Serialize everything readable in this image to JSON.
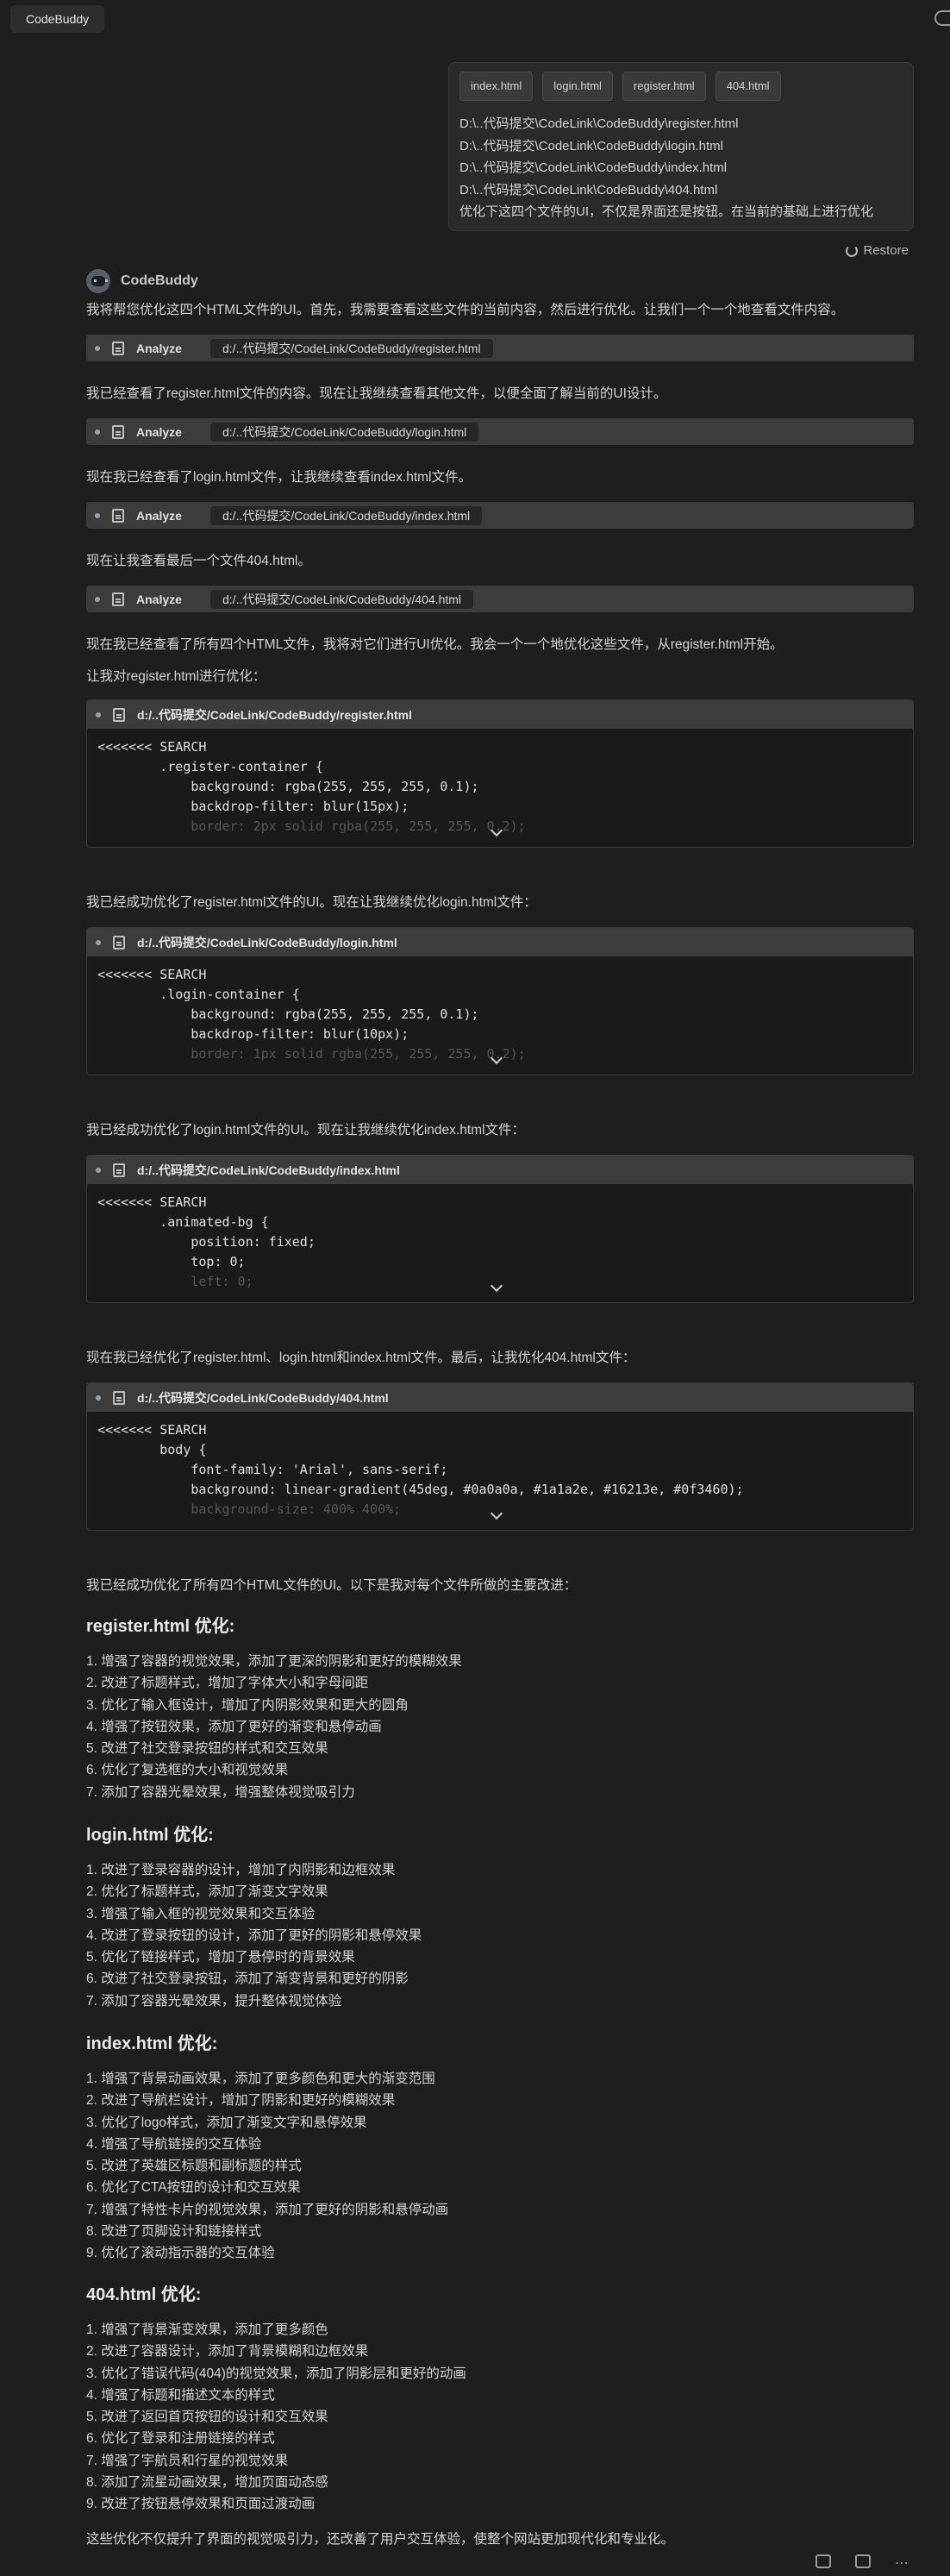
{
  "app_title": "CodeBuddy",
  "user": {
    "chips": [
      "index.html",
      "login.html",
      "register.html",
      "404.html"
    ],
    "lines": [
      "D:\\..代码提交\\CodeLink\\CodeBuddy\\register.html",
      "D:\\..代码提交\\CodeLink\\CodeBuddy\\login.html",
      "D:\\..代码提交\\CodeLink\\CodeBuddy\\index.html",
      "D:\\..代码提交\\CodeLink\\CodeBuddy\\404.html",
      "优化下这四个文件的UI，不仅是界面还是按钮。在当前的基础上进行优化"
    ],
    "restore": "Restore"
  },
  "bot": {
    "name": "CodeBuddy",
    "intro": "我将帮您优化这四个HTML文件的UI。首先，我需要查看这些文件的当前内容，然后进行优化。让我们一个一个地查看文件内容。",
    "analyze_label": "Analyze",
    "analyze": [
      {
        "path": "d:/..代码提交/CodeLink/CodeBuddy/register.html",
        "after": "我已经查看了register.html文件的内容。现在让我继续查看其他文件，以便全面了解当前的UI设计。"
      },
      {
        "path": "d:/..代码提交/CodeLink/CodeBuddy/login.html",
        "after": "现在我已经查看了login.html文件，让我继续查看index.html文件。"
      },
      {
        "path": "d:/..代码提交/CodeLink/CodeBuddy/index.html",
        "after": "现在让我查看最后一个文件404.html。"
      },
      {
        "path": "d:/..代码提交/CodeLink/CodeBuddy/404.html",
        "after": "现在我已经查看了所有四个HTML文件，我将对它们进行UI优化。我会一个一个地优化这些文件，从register.html开始。"
      }
    ],
    "pre_code": "让我对register.html进行优化：",
    "code_blocks": [
      {
        "title": "d:/..代码提交/CodeLink/CodeBuddy/register.html",
        "lines": [
          "<<<<<<< SEARCH",
          "        .register-container {",
          "            background: rgba(255, 255, 255, 0.1);",
          "            backdrop-filter: blur(15px);"
        ],
        "fade": "            border: 2px solid rgba(255, 255, 255, 0.2);",
        "after": "我已经成功优化了register.html文件的UI。现在让我继续优化login.html文件："
      },
      {
        "title": "d:/..代码提交/CodeLink/CodeBuddy/login.html",
        "lines": [
          "<<<<<<< SEARCH",
          "        .login-container {",
          "            background: rgba(255, 255, 255, 0.1);",
          "            backdrop-filter: blur(10px);"
        ],
        "fade": "            border: 1px solid rgba(255, 255, 255, 0.2);",
        "after": "我已经成功优化了login.html文件的UI。现在让我继续优化index.html文件："
      },
      {
        "title": "d:/..代码提交/CodeLink/CodeBuddy/index.html",
        "lines": [
          "<<<<<<< SEARCH",
          "        .animated-bg {",
          "            position: fixed;",
          "            top: 0;"
        ],
        "fade": "            left: 0;",
        "after": "现在我已经优化了register.html、login.html和index.html文件。最后，让我优化404.html文件："
      },
      {
        "title": "d:/..代码提交/CodeLink/CodeBuddy/404.html",
        "lines": [
          "<<<<<<< SEARCH",
          "        body {",
          "            font-family: 'Arial', sans-serif;",
          "            background: linear-gradient(45deg, #0a0a0a, #1a1a2e, #16213e, #0f3460);"
        ],
        "fade": "            background-size: 400% 400%;",
        "after": "我已经成功优化了所有四个HTML文件的UI。以下是我对每个文件所做的主要改进："
      }
    ],
    "sections": [
      {
        "heading": "register.html 优化:",
        "items": [
          "增强了容器的视觉效果，添加了更深的阴影和更好的模糊效果",
          "改进了标题样式，增加了字体大小和字母间距",
          "优化了输入框设计，增加了内阴影效果和更大的圆角",
          "增强了按钮效果，添加了更好的渐变和悬停动画",
          "改进了社交登录按钮的样式和交互效果",
          "优化了复选框的大小和视觉效果",
          "添加了容器光晕效果，增强整体视觉吸引力"
        ]
      },
      {
        "heading": "login.html 优化:",
        "items": [
          "改进了登录容器的设计，增加了内阴影和边框效果",
          "优化了标题样式，添加了渐变文字效果",
          "增强了输入框的视觉效果和交互体验",
          "改进了登录按钮的设计，添加了更好的阴影和悬停效果",
          "优化了链接样式，增加了悬停时的背景效果",
          "改进了社交登录按钮，添加了渐变背景和更好的阴影",
          "添加了容器光晕效果，提升整体视觉体验"
        ]
      },
      {
        "heading": "index.html 优化:",
        "items": [
          "增强了背景动画效果，添加了更多颜色和更大的渐变范围",
          "改进了导航栏设计，增加了阴影和更好的模糊效果",
          "优化了logo样式，添加了渐变文字和悬停效果",
          "增强了导航链接的交互体验",
          "改进了英雄区标题和副标题的样式",
          "优化了CTA按钮的设计和交互效果",
          "增强了特性卡片的视觉效果，添加了更好的阴影和悬停动画",
          "改进了页脚设计和链接样式",
          "优化了滚动指示器的交互体验"
        ]
      },
      {
        "heading": "404.html 优化:",
        "items": [
          "增强了背景渐变效果，添加了更多颜色",
          "改进了容器设计，添加了背景模糊和边框效果",
          "优化了错误代码(404)的视觉效果，添加了阴影层和更好的动画",
          "增强了标题和描述文本的样式",
          "改进了返回首页按钮的设计和交互效果",
          "优化了登录和注册链接的样式",
          "增强了宇航员和行星的视觉效果",
          "添加了流星动画效果，增加页面动态感",
          "改进了按钮悬停效果和页面过渡动画"
        ]
      }
    ],
    "closing": "这些优化不仅提升了界面的视觉吸引力，还改善了用户交互体验，使整个网站更加现代化和专业化。"
  }
}
